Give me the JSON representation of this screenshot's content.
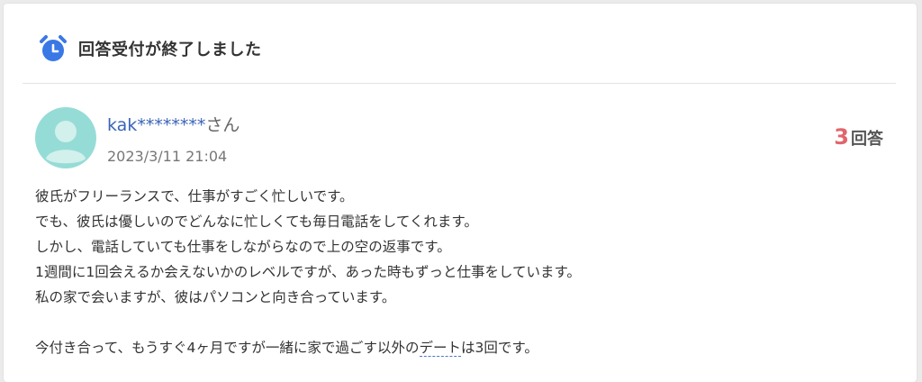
{
  "header": {
    "title": "回答受付が終了しました",
    "icon": "alarm-clock-icon",
    "icon_color": "#3a78e6"
  },
  "post": {
    "username": "kak********",
    "honorific": "さん",
    "date": "2023/3/11 21:04",
    "answer_count": "3",
    "answer_label": "回答",
    "avatar_color": "#96dcd6",
    "body_lines": [
      "彼氏がフリーランスで、仕事がすごく忙しいです。",
      "でも、彼氏は優しいのでどんなに忙しくても毎日電話をしてくれます。",
      "しかし、電話していても仕事をしながらなので上の空の返事です。",
      "1週間に1回会えるか会えないかのレベルですが、あった時もずっと仕事をしています。",
      "私の家で会いますが、彼はパソコンと向き合っています。"
    ],
    "last_line": {
      "before": "今付き合って、もうすぐ4ヶ月ですが一緒に家で過ごす以外の",
      "link": "デート",
      "after": "は3回です。"
    }
  }
}
